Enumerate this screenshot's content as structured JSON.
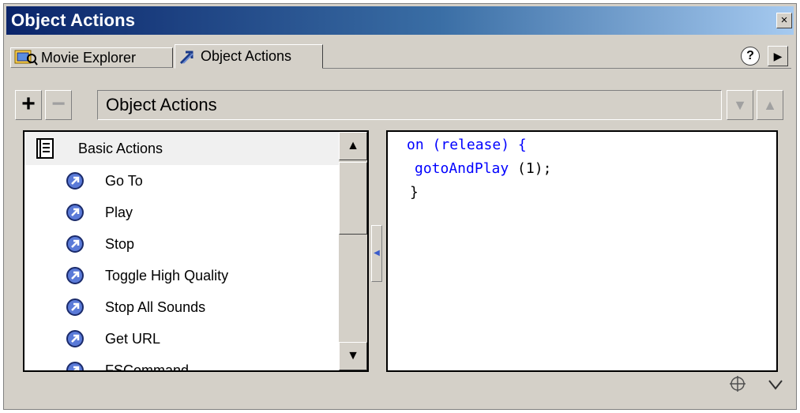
{
  "window": {
    "title": "Object Actions",
    "close_label": "×"
  },
  "tabs": [
    {
      "label": "Movie Explorer",
      "icon": "movie-explorer-icon",
      "active": false
    },
    {
      "label": "Object Actions",
      "icon": "object-actions-icon",
      "active": true
    }
  ],
  "tab_controls": {
    "help_label": "?",
    "menu_label": "▶"
  },
  "toolbar": {
    "add_label": "+",
    "remove_label": "−",
    "field_text": "Object Actions",
    "down_label": "▼",
    "up_label": "▲"
  },
  "action_list": {
    "header": "Basic Actions",
    "items": [
      "Go To",
      "Play",
      "Stop",
      "Toggle High Quality",
      "Stop All Sounds",
      "Get URL",
      "FSCommand"
    ]
  },
  "scrollbar": {
    "up_label": "▲",
    "down_label": "▼"
  },
  "code": {
    "line1_kw": "on",
    "line1_rest": " (release) {",
    "line2_fn": "gotoAndPlay",
    "line2_rest": " (1);",
    "line3": "}"
  },
  "colors": {
    "accent": "#0a246a",
    "code_blue": "#0000ff",
    "chrome": "#d4d0c8"
  }
}
